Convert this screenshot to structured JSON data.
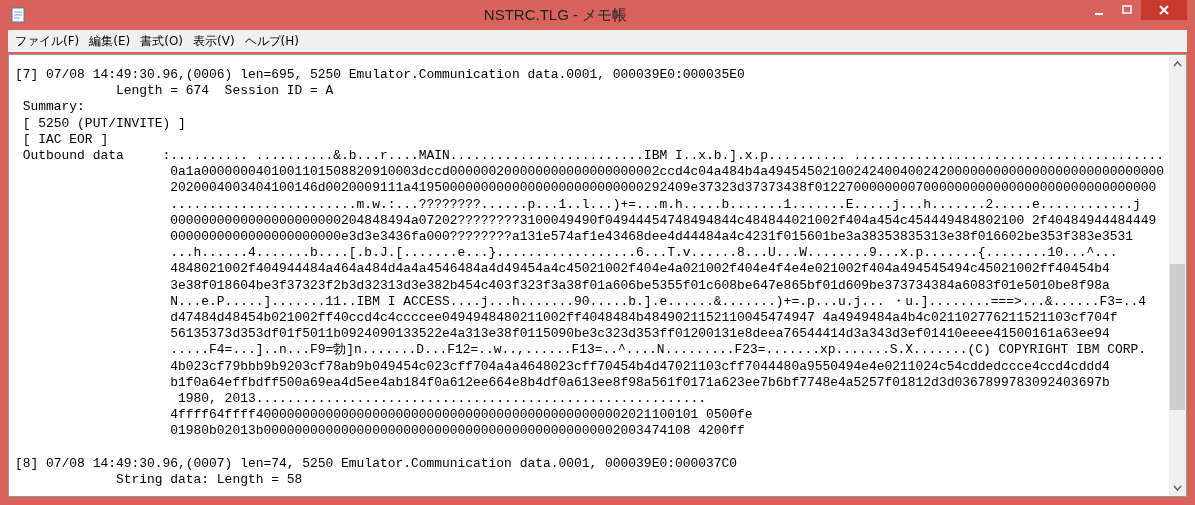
{
  "window": {
    "title": "NSTRC.TLG - メモ帳"
  },
  "menu": [
    "ファイル(F)",
    "編集(E)",
    "書式(O)",
    "表示(V)",
    "ヘルプ(H)"
  ],
  "records": [
    {
      "lines": [
        "[7] 07/08 14:49:30.96,(0006) len=695, 5250 Emulator.Communication data.0001, 000039E0:000035E0",
        "             Length = 674  Session ID = A",
        " Summary:",
        " [ 5250 (PUT/INVITE) ]",
        " [ IAC EOR ]",
        " Outbound data     :.......... ..........&.b...r....MAIN.........................IBM I..x.b.].x.p.......... ........................................",
        "                    0a1a0000000401001101508820910003dccd000000200000000000000000002ccd4c04a484b4a494545021002424004002420000000000000000000000000000",
        "                    2020004003404100146d0020009111a419500000000000000000000000000292409e37323d37373438f01227000000007000000000000000000000000000000",
        "                    ........................m.w.:...????????......p...1..l...)+=...m.h.....b.......1.......E.....j...h.......2.....e............j",
        "                    0000000000000000000000204848494a07202????????3100049490f04944454748494844c484844021002f404a454c454449484802100 2f40484944484449",
        "                    0000000000000000000000e3d3e3436fa000????????a131e574af1e43468dee4d44484a4c4231f015601be3a38353835313e38f016602be353f383e3531",
        "                    ...h......4.......b....[.b.J.[.......e...}..................6...T.v......8...U...W........9...x.p.......{........10...^...",
        "                    4848021002f404944484a464a484d4a4a4546484a4d49454a4c45021002f404e4a021002f404e4f4e4e021002f404a494545494c45021002ff40454b4",
        "                    3e38f018604be3f37323f2b3d32313d3e382b454c403f323f3a38f01a606be5355f01c608be647e865bf01d609be373734384a6083f01e5010be8f98a",
        "                    N...e.P.....].......11..IBM I ACCESS....j...h.......90.....b.].e......&.......)+=.p...u.j... ・u.]........===>...&......F3=..4",
        "                    d47484d48454b021002ff40ccd4c4ccccee0494948480211002ff4048484b4849021152110045474947 4a4949484a4b4c021102776211521103cf704f",
        "                    56135373d353df01f5011b0924090133522e4a313e38f0115090be3c323d353ff01200131e8deea76544414d3a343d3ef01410eeee41500161a63ee94",
        "                    .....F4=...]..n...F9=勃]n.......D...F12=..w..,......F13=..^....N.........F23=.......xp.......S.X.......(C) COPYRIGHT IBM CORP.",
        "                    4b023cf79bbb9b9203cf78ab9b049454c023cff704a4a4648023cff70454b4d47021103cff7044480a9550494e4e0211024c54cddedccce4ccd4cddd4",
        "                    b1f0a64effbdff500a69ea4d5ee4ab184f0a612ee664e8b4df0a613ee8f98a561f0171a623ee7b6bf7748e4a5257f01812d3d0367899783092403697b",
        "                     1980, 2013..........................................................",
        "                    4ffff64ffff400000000000000000000000000000000000000000000002021100101 0500fe",
        "                    01980b02013b0000000000000000000000000000000000000000000002003474108 4200ff"
      ]
    },
    {
      "lines": [
        "[8] 07/08 14:49:30.96,(0007) len=74, 5250 Emulator.Communication data.0001, 000039E0:000037C0",
        "             String data: Length = 58"
      ]
    }
  ]
}
